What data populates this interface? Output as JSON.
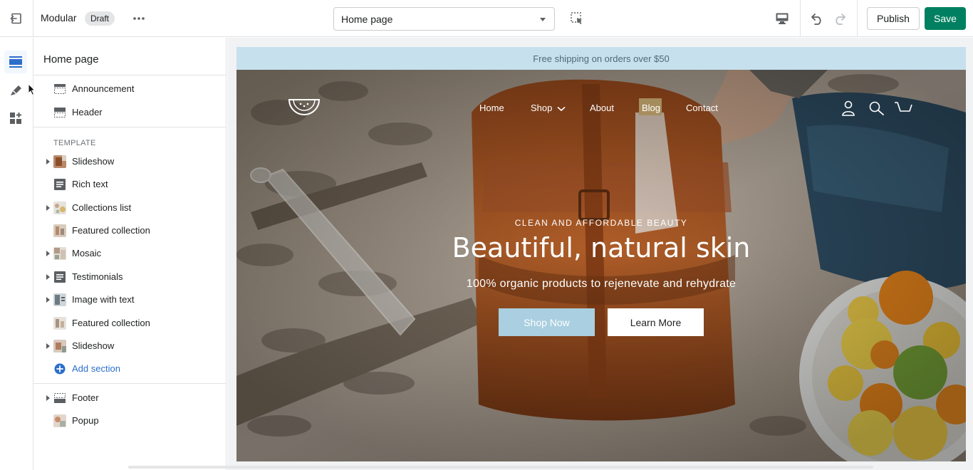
{
  "topbar": {
    "theme_name": "Modular",
    "status_badge": "Draft",
    "page_selector": "Home page",
    "publish_label": "Publish",
    "save_label": "Save"
  },
  "sidebar": {
    "title": "Home page",
    "top_items": [
      {
        "label": "Announcement",
        "icon": "announcement-icon"
      },
      {
        "label": "Header",
        "icon": "header-icon"
      }
    ],
    "template_heading": "TEMPLATE",
    "template_items": [
      {
        "label": "Slideshow",
        "icon": "slideshow-thumb",
        "expandable": true
      },
      {
        "label": "Rich text",
        "icon": "text-icon",
        "expandable": false
      },
      {
        "label": "Collections list",
        "icon": "collections-thumb",
        "expandable": true
      },
      {
        "label": "Featured collection",
        "icon": "collection-thumb",
        "expandable": false
      },
      {
        "label": "Mosaic",
        "icon": "mosaic-thumb",
        "expandable": true
      },
      {
        "label": "Testimonials",
        "icon": "text-icon",
        "expandable": true
      },
      {
        "label": "Image with text",
        "icon": "image-thumb",
        "expandable": true
      },
      {
        "label": "Featured collection",
        "icon": "collection-thumb",
        "expandable": false
      },
      {
        "label": "Slideshow",
        "icon": "slideshow-thumb",
        "expandable": true
      }
    ],
    "add_section_label": "Add section",
    "bottom_items": [
      {
        "label": "Footer",
        "icon": "footer-icon",
        "expandable": true
      },
      {
        "label": "Popup",
        "icon": "popup-thumb",
        "expandable": false
      }
    ]
  },
  "preview": {
    "announcement": "Free shipping on orders over $50",
    "nav": [
      "Home",
      "Shop",
      "About",
      "Blog",
      "Contact"
    ],
    "eyebrow": "CLEAN AND AFFORDABLE BEAUTY",
    "headline": "Beautiful, natural skin",
    "subline": "100% organic products to rejenevate and rehydrate",
    "primary_button": "Shop Now",
    "secondary_button": "Learn More"
  },
  "colors": {
    "accent": "#008060",
    "link": "#2c6ecb",
    "announcement_bg": "#c6e0ee",
    "shop_button": "#a9cfe0"
  }
}
